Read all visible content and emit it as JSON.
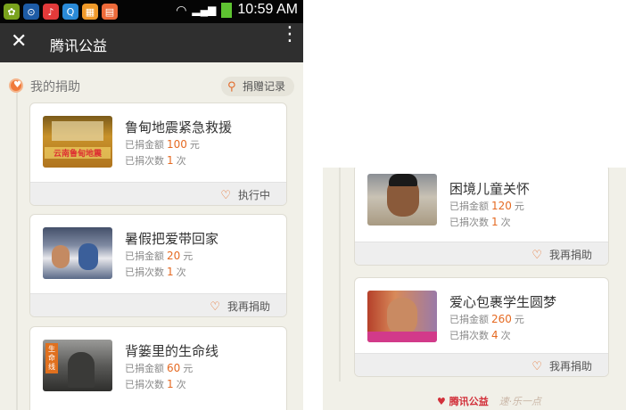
{
  "status_bar": {
    "time": "10:59 AM"
  },
  "app": {
    "title": "腾讯公益"
  },
  "section": {
    "title": "我的捐助",
    "record_button": "捐赠记录"
  },
  "labels": {
    "amount": "已捐金额",
    "count": "已捐次数",
    "yuan": "元",
    "times": "次"
  },
  "left_cards": [
    {
      "title": "鲁甸地震紧急救援",
      "amount": "100",
      "count": "1",
      "action": "执行中"
    },
    {
      "title": "暑假把爱带回家",
      "amount": "20",
      "count": "1",
      "action": "我再捐助"
    },
    {
      "title": "背篓里的生命线",
      "amount": "60",
      "count": "1",
      "action": ""
    }
  ],
  "right_cards": [
    {
      "title": "困境儿童关怀",
      "amount": "120",
      "count": "1",
      "action": "我再捐助"
    },
    {
      "title": "爱心包裹学生圆梦",
      "amount": "260",
      "count": "4",
      "action": "我再捐助"
    }
  ],
  "thumb_texts": {
    "quake": "云南鲁甸地震",
    "lifeline_tag": "生命线"
  },
  "brand": {
    "name": "腾讯公益",
    "signature": "速·乐一点"
  },
  "colors": {
    "accent": "#e56a22",
    "title_bar": "#2f2f2f",
    "status_bar": "#050505",
    "background": "#f1f0e8"
  }
}
